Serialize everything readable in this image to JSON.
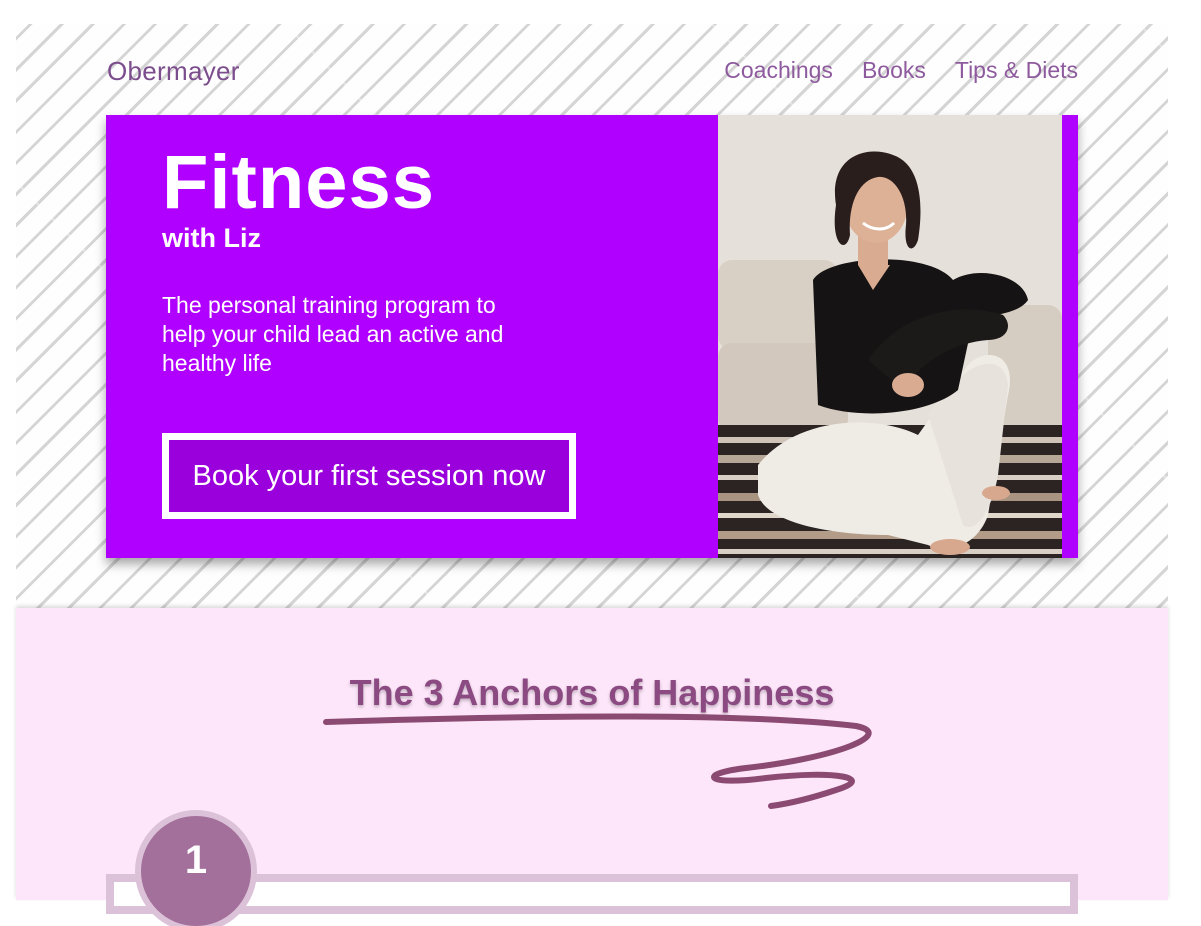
{
  "header": {
    "brand": "Obermayer",
    "nav": [
      "Coachings",
      "Books",
      "Tips & Diets"
    ]
  },
  "hero": {
    "title": "Fitness",
    "subtitle": "with Liz",
    "description": "The personal training program to help your child lead an active and healthy life",
    "cta_label": "Book your first session now"
  },
  "anchors": {
    "title": "The 3 Anchors of Happiness",
    "steps": [
      {
        "number": "1"
      }
    ]
  },
  "colors": {
    "hero_bg": "#b000ff",
    "accent": "#8b4a82",
    "section_bg": "#fde6f9"
  }
}
